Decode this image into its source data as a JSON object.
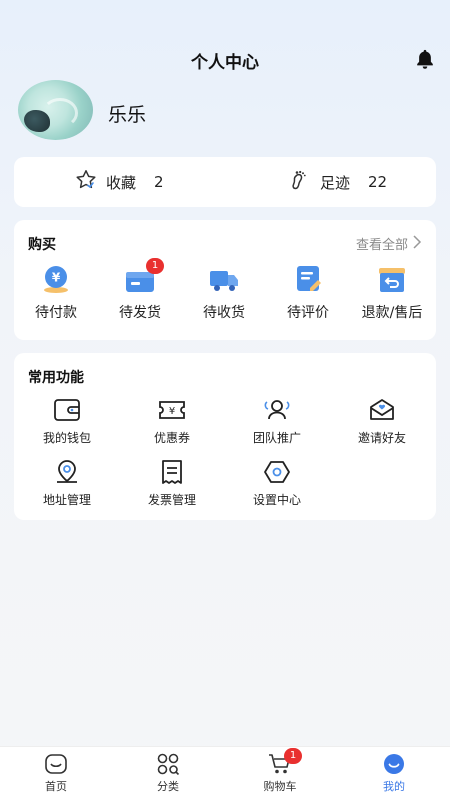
{
  "header": {
    "title": "个人中心"
  },
  "profile": {
    "name": "乐乐"
  },
  "stats": [
    {
      "label": "收藏",
      "count": "2",
      "icon": "star-icon"
    },
    {
      "label": "足迹",
      "count": "22",
      "icon": "footprint-icon"
    }
  ],
  "purchase": {
    "title": "购买",
    "view_all": "查看全部",
    "items": [
      {
        "label": "待付款",
        "icon": "wallet-yen-icon",
        "badge": ""
      },
      {
        "label": "待发货",
        "icon": "package-icon",
        "badge": "1"
      },
      {
        "label": "待收货",
        "icon": "truck-icon",
        "badge": ""
      },
      {
        "label": "待评价",
        "icon": "edit-icon",
        "badge": ""
      },
      {
        "label": "退款/售后",
        "icon": "return-box-icon",
        "badge": ""
      }
    ]
  },
  "functions": {
    "title": "常用功能",
    "items": [
      {
        "label": "我的钱包",
        "icon": "wallet-icon"
      },
      {
        "label": "优惠券",
        "icon": "coupon-icon"
      },
      {
        "label": "团队推广",
        "icon": "team-icon"
      },
      {
        "label": "邀请好友",
        "icon": "envelope-icon"
      },
      {
        "label": "地址管理",
        "icon": "location-icon"
      },
      {
        "label": "发票管理",
        "icon": "invoice-icon"
      },
      {
        "label": "设置中心",
        "icon": "settings-hex-icon"
      }
    ]
  },
  "tabbar": {
    "items": [
      {
        "label": "首页",
        "icon": "home-icon"
      },
      {
        "label": "分类",
        "icon": "category-icon"
      },
      {
        "label": "购物车",
        "icon": "cart-icon",
        "badge": "1"
      },
      {
        "label": "我的",
        "icon": "profile-icon"
      }
    ],
    "active": "我的"
  },
  "colors": {
    "accent": "#3a78e6",
    "badge": "#e9302f",
    "icon_blue": "#4a8fe8"
  }
}
